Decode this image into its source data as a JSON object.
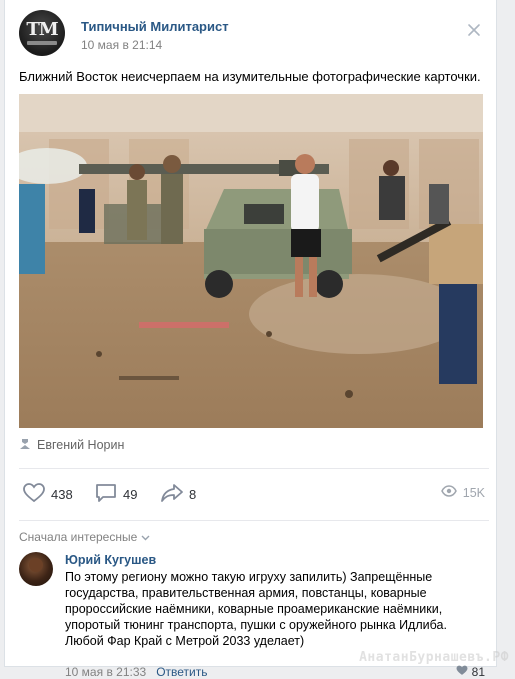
{
  "post": {
    "author": "Типичный Милитарист",
    "avatar_text": "ТМ",
    "time": "10 мая в 21:14",
    "text": "Ближний Восток неисчерпаем на изумительные фотографические карточки.",
    "photo_credit": "Евгений Норин"
  },
  "actions": {
    "likes": "438",
    "comments": "49",
    "shares": "8",
    "views": "15K"
  },
  "comments_section": {
    "sort_label": "Сначала интересные",
    "comment": {
      "author": "Юрий Кугушев",
      "text": "По этому региону можно такую игруху запилить) Запрещённые государства, правительственная армия, повстанцы, коварные пророссийские наёмники, коварные проамериканские наёмники, упоротый тюнинг транспорта, пушки с оружейного рынка Идлиба. Любой Фар Край с Метрой 2033 уделает)",
      "time": "10 мая в 21:33",
      "reply_label": "Ответить",
      "likes": "81"
    }
  },
  "watermark": "АнатанБурнашевъ.РФ",
  "colors": {
    "link": "#2a5885",
    "muted": "#828282",
    "icon": "#99a2ad"
  },
  "icons": [
    "more-icon",
    "camera-icon",
    "heart-icon",
    "comment-icon",
    "share-icon",
    "eye-icon",
    "chevron-down-icon"
  ]
}
